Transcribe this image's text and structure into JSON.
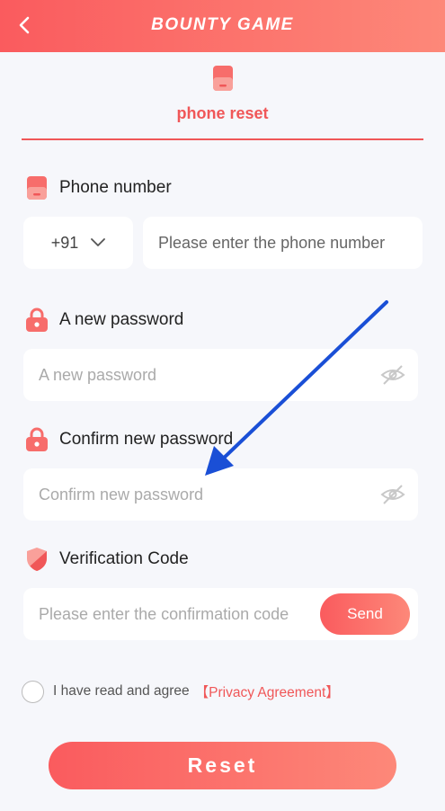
{
  "header": {
    "logo": "BOUNTY GAME",
    "back_icon": "chevron-left-icon"
  },
  "tab": {
    "label": "phone reset",
    "icon": "phone-icon",
    "accent": "#f05758"
  },
  "phone": {
    "label": "Phone number",
    "country_code": "+91",
    "placeholder": "Please enter the phone number",
    "value": ""
  },
  "new_password": {
    "label": "A new password",
    "placeholder": "A new password",
    "value": "",
    "icon": "lock-icon"
  },
  "confirm_password": {
    "label": "Confirm new password",
    "placeholder": "Confirm new password",
    "value": "",
    "icon": "lock-icon"
  },
  "verification": {
    "label": "Verification Code",
    "placeholder": "Please enter the confirmation code",
    "value": "",
    "send_label": "Send",
    "icon": "shield-icon"
  },
  "agreement": {
    "text": "I have read and agree",
    "link": "【Privacy Agreement】",
    "checked": false
  },
  "submit": {
    "label": "Reset"
  },
  "colors": {
    "gradient_start": "#fa5b5e",
    "gradient_end": "#fd8879",
    "background": "#f6f7fb",
    "annotation_arrow": "#1a4fd6"
  }
}
